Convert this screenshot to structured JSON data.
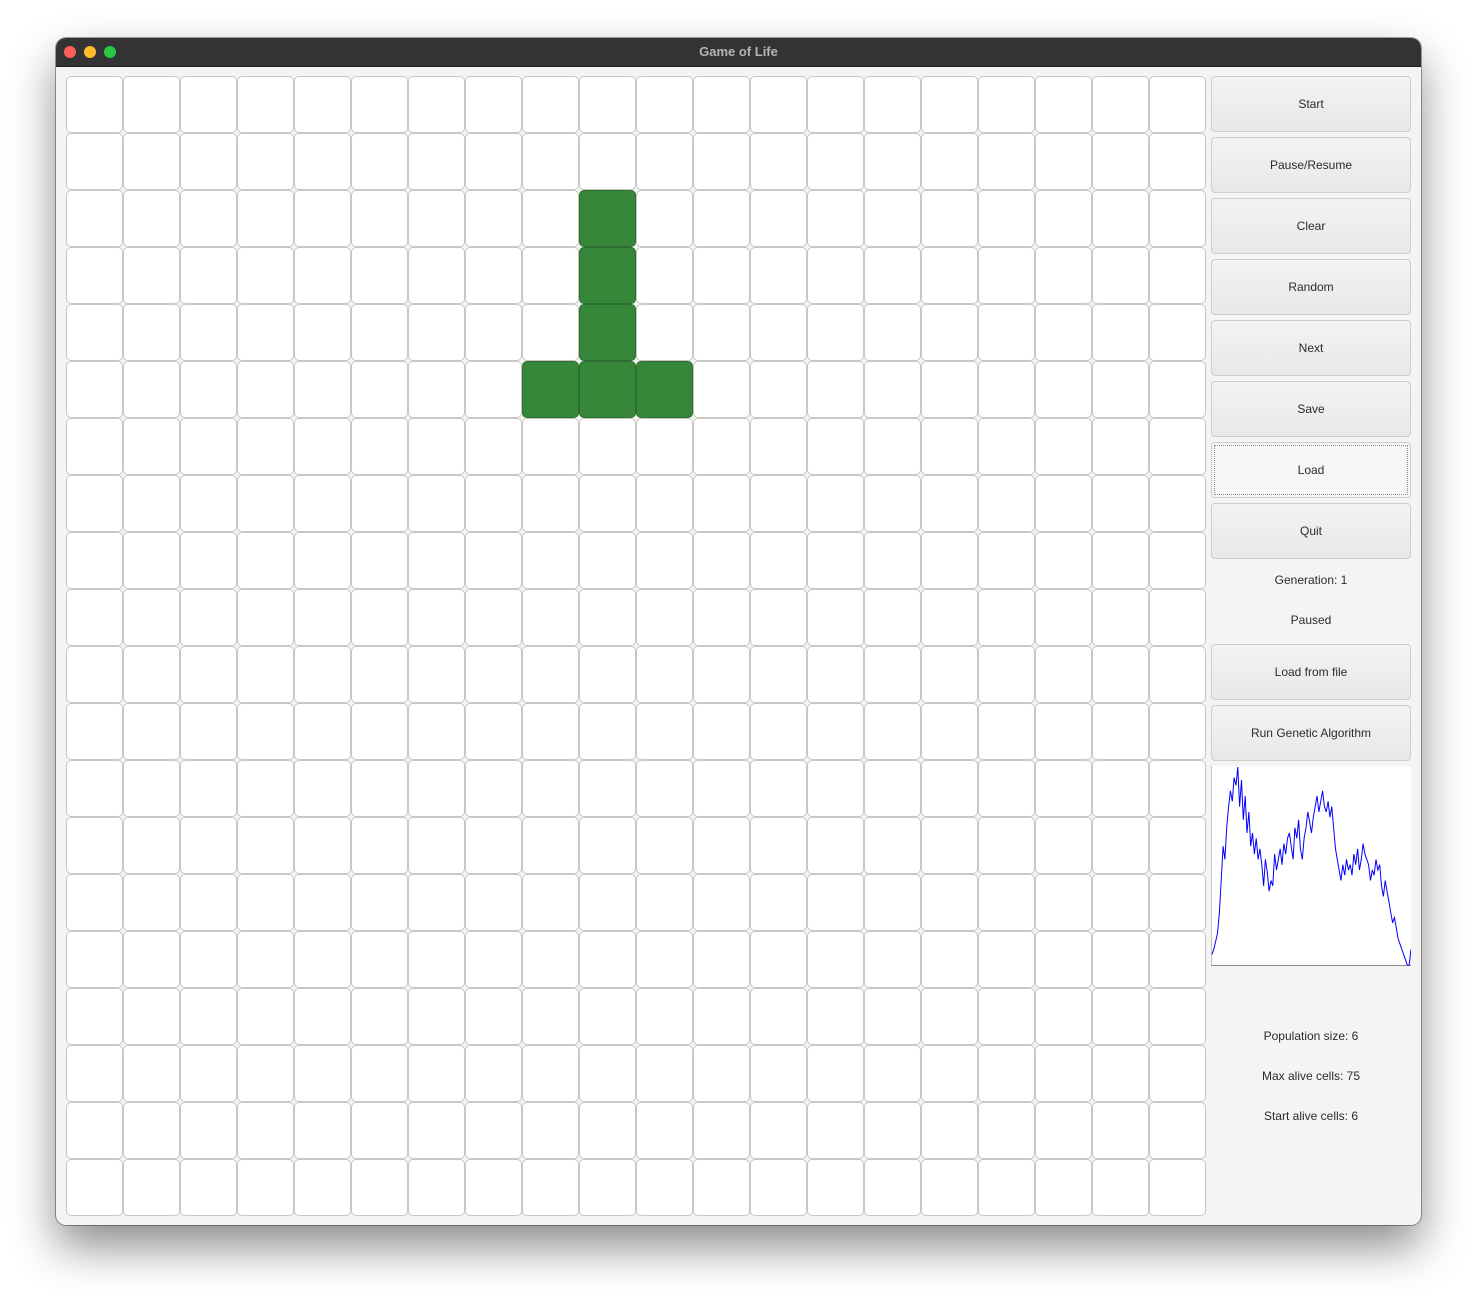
{
  "window": {
    "title": "Game of Life"
  },
  "board": {
    "rows": 20,
    "cols": 20,
    "alive_cells": [
      [
        2,
        9
      ],
      [
        3,
        9
      ],
      [
        4,
        9
      ],
      [
        5,
        8
      ],
      [
        5,
        9
      ],
      [
        5,
        10
      ]
    ],
    "alive_color": "#37873a",
    "dead_color": "#ffffff"
  },
  "controls": {
    "start": "Start",
    "pause_resume": "Pause/Resume",
    "clear": "Clear",
    "random": "Random",
    "next": "Next",
    "save": "Save",
    "load": "Load",
    "quit": "Quit",
    "load_from_file": "Load from file",
    "run_genetic": "Run Genetic Algorithm"
  },
  "status": {
    "generation": "Generation: 1",
    "state": "Paused"
  },
  "stats": {
    "population_size": "Population size: 6",
    "max_alive": "Max alive cells: 75",
    "start_alive": "Start alive cells: 6"
  },
  "chart_data": {
    "type": "line",
    "line_color": "#0000ff",
    "ylim": [
      0,
      75
    ],
    "series": [
      {
        "values": [
          4,
          6,
          9,
          12,
          20,
          32,
          45,
          40,
          52,
          60,
          66,
          62,
          71,
          68,
          75,
          60,
          70,
          55,
          64,
          50,
          58,
          45,
          50,
          42,
          48,
          40,
          44,
          38,
          30,
          40,
          35,
          28,
          32,
          30,
          42,
          36,
          40,
          44,
          38,
          46,
          42,
          48,
          50,
          45,
          40,
          52,
          48,
          55,
          44,
          40,
          48,
          52,
          58,
          54,
          50,
          56,
          60,
          64,
          58,
          62,
          66,
          60,
          58,
          62,
          56,
          60,
          52,
          44,
          40,
          36,
          32,
          38,
          34,
          40,
          36,
          38,
          34,
          42,
          38,
          44,
          36,
          40,
          46,
          42,
          40,
          38,
          32,
          36,
          34,
          40,
          36,
          38,
          30,
          26,
          32,
          28,
          24,
          20,
          16,
          18,
          14,
          10,
          8,
          6,
          4,
          2,
          0,
          0,
          6
        ]
      }
    ]
  }
}
